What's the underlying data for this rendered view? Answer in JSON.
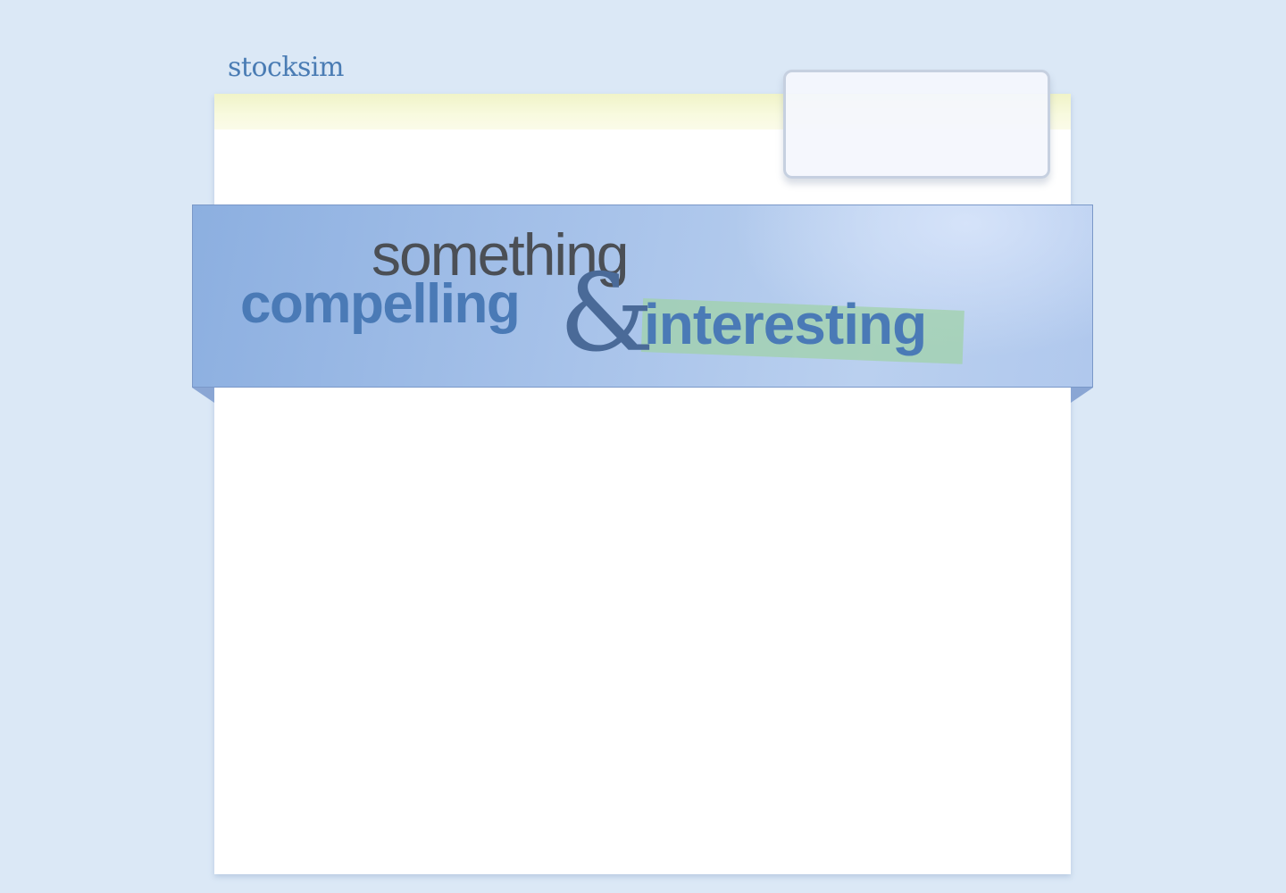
{
  "header": {
    "logo_text": "stocksim"
  },
  "banner": {
    "line1": "something",
    "line2": "compelling",
    "ampersand": "&",
    "line3": "interesting"
  },
  "colors": {
    "page_background": "#dbe8f6",
    "brand_blue": "#4a7cb4",
    "banner_blue": "#a8c3ea",
    "highlight_green": "#a0d2aa",
    "strip_yellow": "#f8fadf"
  }
}
